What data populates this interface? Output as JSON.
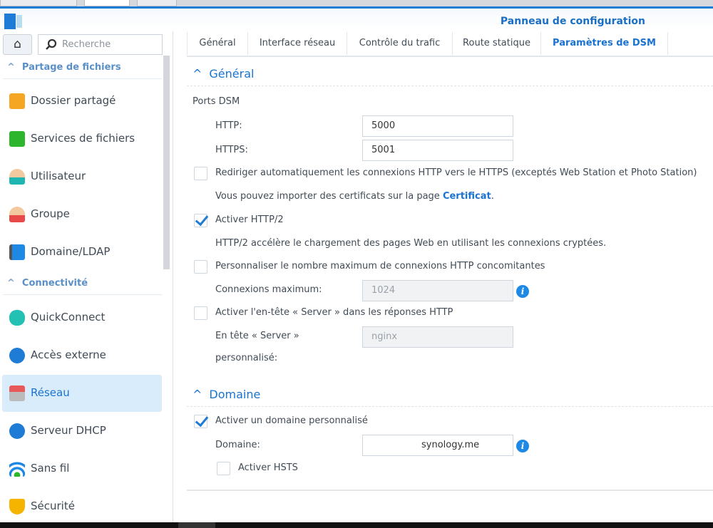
{
  "window": {
    "title": "Panneau de configuration"
  },
  "sidebar": {
    "search_placeholder": "Recherche",
    "categories": [
      {
        "label": "Partage de fichiers"
      },
      {
        "label": "Connectivité"
      }
    ],
    "items": [
      {
        "label": "Dossier partagé",
        "icon": "shared-folder-icon",
        "color": "#f5a623"
      },
      {
        "label": "Services de fichiers",
        "icon": "file-services-icon",
        "color": "#2db52d"
      },
      {
        "label": "Utilisateur",
        "icon": "user-icon",
        "color": "#1fb5b0"
      },
      {
        "label": "Groupe",
        "icon": "group-icon",
        "color": "#e84a4a"
      },
      {
        "label": "Domaine/LDAP",
        "icon": "domain-ldap-icon",
        "color": "#1e88e5"
      },
      {
        "label": "QuickConnect",
        "icon": "quickconnect-icon",
        "color": "#22c1b4"
      },
      {
        "label": "Accès externe",
        "icon": "globe-icon",
        "color": "#1e7bd6"
      },
      {
        "label": "Réseau",
        "icon": "network-icon",
        "color": "#e85a5a"
      },
      {
        "label": "Serveur DHCP",
        "icon": "dhcp-icon",
        "color": "#1e7bd6"
      },
      {
        "label": "Sans fil",
        "icon": "wifi-icon",
        "color": "#1e88e5"
      },
      {
        "label": "Sécurité",
        "icon": "shield-icon",
        "color": "#f5b400"
      }
    ]
  },
  "tabs": [
    "Général",
    "Interface réseau",
    "Contrôle du trafic",
    "Route statique",
    "Paramètres de DSM"
  ],
  "general": {
    "title": "Général",
    "ports_label": "Ports DSM",
    "http_label": "HTTP:",
    "http_value": "5000",
    "https_label": "HTTPS:",
    "https_value": "5001",
    "redirect_label": "Rediriger automatiquement les connexions HTTP vers le HTTPS (exceptés Web Station et Photo Station)",
    "redirect_checked": false,
    "cert_text": "Vous pouvez importer des certificats sur la page ",
    "cert_link": "Certificat",
    "cert_end": ".",
    "http2_label": "Activer HTTP/2",
    "http2_checked": true,
    "http2_desc": "HTTP/2 accélère le chargement des pages Web en utilisant les connexions cryptées.",
    "maxconn_check_label": "Personnaliser le nombre maximum de connexions HTTP concomitantes",
    "maxconn_checked": false,
    "maxconn_label": "Connexions maximum:",
    "maxconn_value": "1024",
    "server_header_check_label": "Activer l'en-tête « Server » dans les réponses HTTP",
    "server_header_checked": false,
    "server_header_label1": "En tête « Server »",
    "server_header_label2": "personnalisé:",
    "server_header_value": "nginx"
  },
  "domain": {
    "title": "Domaine",
    "enable_label": "Activer un domaine personnalisé",
    "enable_checked": true,
    "domain_label": "Domaine:",
    "domain_value": "synology.me",
    "hsts_label": "Activer HSTS",
    "hsts_checked": false
  }
}
